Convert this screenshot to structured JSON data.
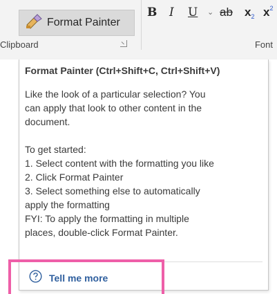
{
  "ribbon": {
    "format_painter_label": "Format Painter",
    "clipboard_group_label": "Clipboard",
    "font_group_label": "Font",
    "format_buttons": {
      "bold": "B",
      "italic": "I",
      "underline": "U",
      "dropdown": "⌄",
      "strikethrough": "ab",
      "subscript": "x",
      "subscript_mark": "2",
      "superscript": "x",
      "superscript_mark": "2"
    }
  },
  "tooltip": {
    "title": "Format Painter (Ctrl+Shift+C, Ctrl+Shift+V)",
    "lines_p1": [
      "Like the look of a particular selection? You",
      "can apply that look to other content in the",
      "document."
    ],
    "lines_p2": [
      "To get started:",
      "1. Select content with the formatting you like",
      "2. Click Format Painter",
      "3. Select something else to automatically",
      "apply the formatting"
    ],
    "lines_p3": [
      "FYI: To apply the formatting in multiple",
      "places, double-click Format Painter."
    ],
    "tell_me_more": "Tell me more"
  },
  "colors": {
    "highlight": "#ee5fa8",
    "link": "#2f5f9e",
    "ribbon_bg": "#f3f3f3"
  },
  "icons": [
    "format-painter-brush-icon",
    "help-circle-icon",
    "dialog-launcher-icon"
  ]
}
